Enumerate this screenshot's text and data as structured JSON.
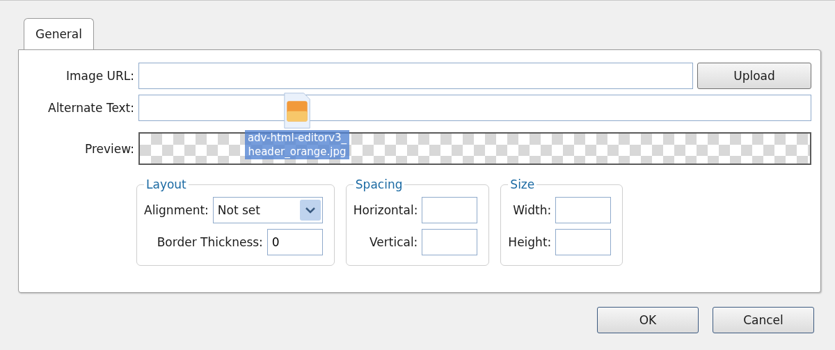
{
  "tabs": [
    {
      "label": "General",
      "selected": true
    }
  ],
  "rows": [
    {
      "kind": "url",
      "label": "Image URL:",
      "value": "",
      "button": "Upload"
    },
    {
      "kind": "text",
      "label": "Alternate Text:",
      "value": ""
    },
    {
      "kind": "preview",
      "label": "Preview:"
    }
  ],
  "groups": [
    {
      "legend": "Layout",
      "fields": [
        {
          "kind": "select",
          "label": "Alignment:",
          "value": "Not set"
        },
        {
          "kind": "text",
          "label": "Border Thickness:",
          "value": "0"
        }
      ]
    },
    {
      "legend": "Spacing",
      "fields": [
        {
          "kind": "text",
          "label": "Horizontal:"
        },
        {
          "kind": "text",
          "label": "Vertical:"
        }
      ]
    },
    {
      "legend": "Size",
      "fields": [
        {
          "kind": "text",
          "label": "Width:"
        },
        {
          "kind": "text",
          "label": "Height:"
        }
      ]
    }
  ],
  "drag_ghost": {
    "filename": "adv-html-editorv3_header_orange.jpg"
  },
  "buttons": [
    "OK",
    "Cancel"
  ]
}
